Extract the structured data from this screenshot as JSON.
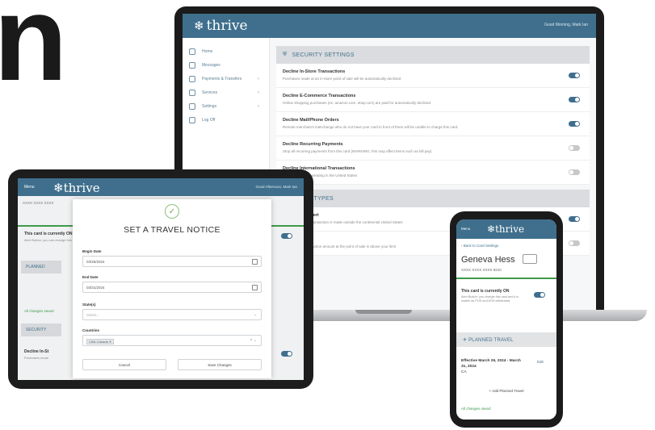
{
  "hero_letter": "n",
  "brand": {
    "name": "thrive",
    "mark": "❄"
  },
  "laptop": {
    "user": "Good Morning, Mark Ian",
    "nav": [
      {
        "label": "Home",
        "chevron": ""
      },
      {
        "label": "Messages",
        "chevron": ""
      },
      {
        "label": "Payments & Transfers",
        "chevron": "›"
      },
      {
        "label": "Services",
        "chevron": "›"
      },
      {
        "label": "Settings",
        "chevron": "›"
      },
      {
        "label": "Log Off",
        "chevron": ""
      }
    ],
    "section_security": "SECURITY SETTINGS",
    "rows": [
      {
        "title": "Decline In-Store Transactions",
        "desc": "Purchases made at an in-store point of sale will be automatically declined",
        "on": true
      },
      {
        "title": "Decline E-Commerce Transactions",
        "desc": "Online shopping purchases (ex: amazon.com, ebay.com) are paid for automatically declined",
        "on": true
      },
      {
        "title": "Decline Mail/Phone Orders",
        "desc": "Remote merchant's interchange who do not have your card in front of them will be unable to charge this card.",
        "on": true
      },
      {
        "title": "Decline Recurring Payments",
        "desc": "Stop all recurring payments from this card (WARNING: this may affect items such as bill pay)",
        "on": false
      },
      {
        "title": "Decline International Transactions",
        "desc": "Limit to vendors operating in the United States",
        "on": false
      }
    ],
    "section_alert": "ALERT TYPES",
    "alert_rows": [
      {
        "title": "Transaction Alert",
        "desc": "Alert whenever a transaction is made outside the continental United States",
        "on": true
      },
      {
        "title": "Amount Alert",
        "desc": "Alert when a transaction amount at the point of sale is above your limit",
        "on": false
      }
    ]
  },
  "tablet": {
    "menu": "Menu",
    "user": "Good Afternoon, Mark Ian",
    "account_line": "XXXX XXXX XXXX",
    "card_on": "This card is currently ON",
    "card_on_sub": "Alert Button: you can change this card",
    "planned": "PLANNED",
    "all_changes": "All changes saved",
    "security": "SECURITY",
    "decline": "Decline In-St",
    "decline_sub": "Purchases made",
    "modal": {
      "check": "✓",
      "title": "SET A TRAVEL NOTICE",
      "begin_label": "Begin Date",
      "begin_value": "03/26/2024",
      "end_label": "End Date",
      "end_value": "03/31/2024",
      "states_label": "State(s)",
      "states_placeholder": "Select...",
      "countries_label": "Countries",
      "country_tag": "CAN-Canada  ✕",
      "clear_icon": "× ⌄",
      "cancel": "Cancel",
      "save": "Save Changes"
    }
  },
  "phone": {
    "menu": "Menu",
    "back": "‹ Back to Card Settings",
    "name": "Geneva Hess",
    "number": "XXXX XXXX XXXX 8210",
    "card_on": "This card is currently ON",
    "card_on_sub": "Alert Button: you change this card and it is usable as POS and ATM withdrawal",
    "planned": "PLANNED TRAVEL",
    "effective": "Effective March 26, 2024 - March 31, 2024",
    "effective_sub": "CA",
    "edit": "Edit",
    "add": "+ Add Planned Travel",
    "saved": "All changes saved"
  },
  "colors": {
    "brand_blue": "#3f6f8d",
    "success_green": "#3e9a4a"
  }
}
